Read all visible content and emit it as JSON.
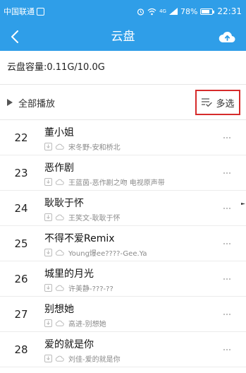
{
  "status_bar": {
    "carrier": "中国联通",
    "carrier_badge": "☰",
    "network_label": "4G",
    "signal": "Ⅱ",
    "battery_text": "78%",
    "battery_level": 0.78,
    "time": "22:31"
  },
  "header": {
    "title": "云盘",
    "back_icon": "chevron-left-icon",
    "upload_icon": "cloud-upload-icon",
    "background": "#2f9ee8"
  },
  "capacity": {
    "text": "云盘容量:0.11G/10.0G"
  },
  "actions": {
    "play_all_label": "全部播放",
    "multi_select_label": "多选",
    "highlight_color": "#d62b2b"
  },
  "songs": [
    {
      "num": "22",
      "title": "董小姐",
      "artist": "宋冬野-安和桥北"
    },
    {
      "num": "23",
      "title": "恶作剧",
      "artist": "王蓝茵-恶作剧之吻 电视原声带"
    },
    {
      "num": "24",
      "title": "耿耿于怀",
      "artist": "王笑文-耿耿于怀"
    },
    {
      "num": "25",
      "title": "不得不爱Remix",
      "artist": "Young爆ee????-Gee.Ya"
    },
    {
      "num": "26",
      "title": "城里的月光",
      "artist": "许美静-???-??"
    },
    {
      "num": "27",
      "title": "别想她",
      "artist": "高进-别想她"
    },
    {
      "num": "28",
      "title": "爱的就是你",
      "artist": "刘佳-爱的就是你"
    }
  ]
}
